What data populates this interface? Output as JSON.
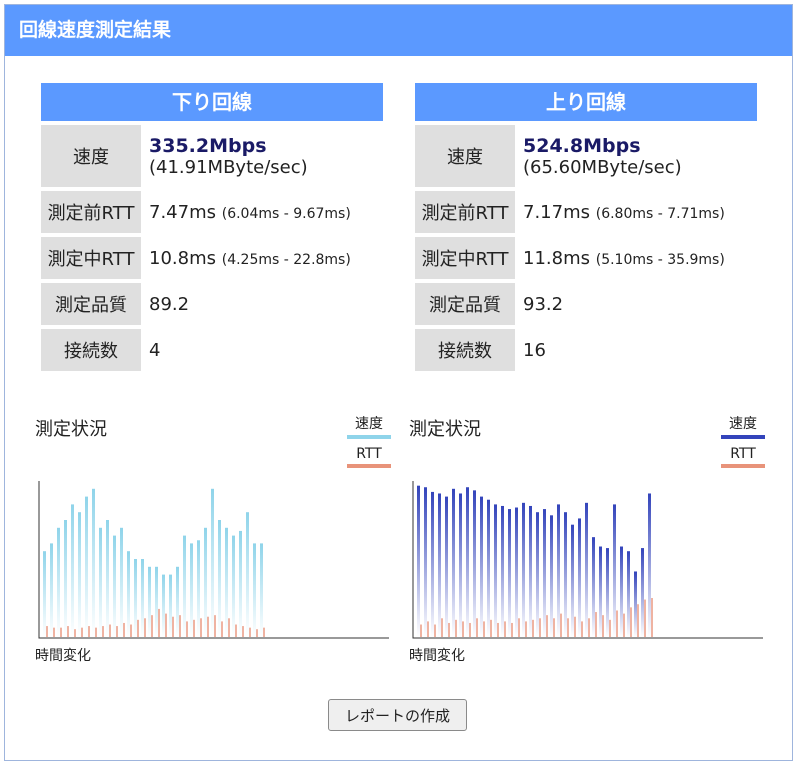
{
  "header": {
    "title": "回線速度測定結果"
  },
  "down": {
    "title": "下り回線",
    "rows": [
      {
        "label": "速度",
        "main": "335.2Mbps",
        "sub": "(41.91MByte/sec)"
      },
      {
        "label": "測定前RTT",
        "main": "7.47ms",
        "small": "(6.04ms - 9.67ms)"
      },
      {
        "label": "測定中RTT",
        "main": "10.8ms",
        "small": "(4.25ms - 22.8ms)"
      },
      {
        "label": "測定品質",
        "main": "89.2"
      },
      {
        "label": "接続数",
        "main": "4"
      }
    ],
    "chart": {
      "title": "測定状況",
      "legend_speed": "速度",
      "legend_rtt": "RTT",
      "xlabel": "時間変化",
      "speed_color": "#8fd4ea",
      "rtt_color": "#e8937a"
    }
  },
  "up": {
    "title": "上り回線",
    "rows": [
      {
        "label": "速度",
        "main": "524.8Mbps",
        "sub": "(65.60MByte/sec)"
      },
      {
        "label": "測定前RTT",
        "main": "7.17ms",
        "small": "(6.80ms - 7.71ms)"
      },
      {
        "label": "測定中RTT",
        "main": "11.8ms",
        "small": "(5.10ms - 35.9ms)"
      },
      {
        "label": "測定品質",
        "main": "93.2"
      },
      {
        "label": "接続数",
        "main": "16"
      }
    ],
    "chart": {
      "title": "測定状況",
      "legend_speed": "速度",
      "legend_rtt": "RTT",
      "xlabel": "時間変化",
      "speed_color": "#3344bb",
      "rtt_color": "#e8937a"
    }
  },
  "report_button": "レポートの作成",
  "chart_data": [
    {
      "type": "bar",
      "series": [
        {
          "name": "速度",
          "values": [
            0.55,
            0.6,
            0.7,
            0.75,
            0.85,
            0.8,
            0.9,
            0.95,
            0.7,
            0.75,
            0.65,
            0.7,
            0.55,
            0.5,
            0.5,
            0.45,
            0.45,
            0.4,
            0.4,
            0.45,
            0.65,
            0.6,
            0.62,
            0.7,
            0.95,
            0.75,
            0.7,
            0.65,
            0.68,
            0.8,
            0.6,
            0.6
          ]
        },
        {
          "name": "RTT",
          "values": [
            0.07,
            0.06,
            0.06,
            0.07,
            0.05,
            0.06,
            0.07,
            0.06,
            0.07,
            0.08,
            0.07,
            0.09,
            0.08,
            0.11,
            0.12,
            0.14,
            0.18,
            0.15,
            0.13,
            0.14,
            0.1,
            0.11,
            0.12,
            0.13,
            0.14,
            0.1,
            0.12,
            0.08,
            0.07,
            0.06,
            0.05,
            0.06
          ]
        }
      ]
    },
    {
      "type": "bar",
      "series": [
        {
          "name": "速度",
          "values": [
            0.97,
            0.96,
            0.93,
            0.92,
            0.9,
            0.95,
            0.92,
            0.96,
            0.94,
            0.9,
            0.88,
            0.85,
            0.84,
            0.82,
            0.83,
            0.86,
            0.84,
            0.8,
            0.82,
            0.78,
            0.85,
            0.8,
            0.72,
            0.76,
            0.86,
            0.64,
            0.58,
            0.57,
            0.85,
            0.58,
            0.55,
            0.42,
            0.57,
            0.92
          ]
        },
        {
          "name": "RTT",
          "values": [
            0.08,
            0.1,
            0.08,
            0.12,
            0.09,
            0.11,
            0.1,
            0.09,
            0.12,
            0.1,
            0.11,
            0.09,
            0.1,
            0.09,
            0.12,
            0.1,
            0.11,
            0.12,
            0.14,
            0.12,
            0.15,
            0.12,
            0.13,
            0.1,
            0.12,
            0.16,
            0.14,
            0.11,
            0.17,
            0.15,
            0.19,
            0.21,
            0.24,
            0.25
          ]
        }
      ]
    }
  ]
}
